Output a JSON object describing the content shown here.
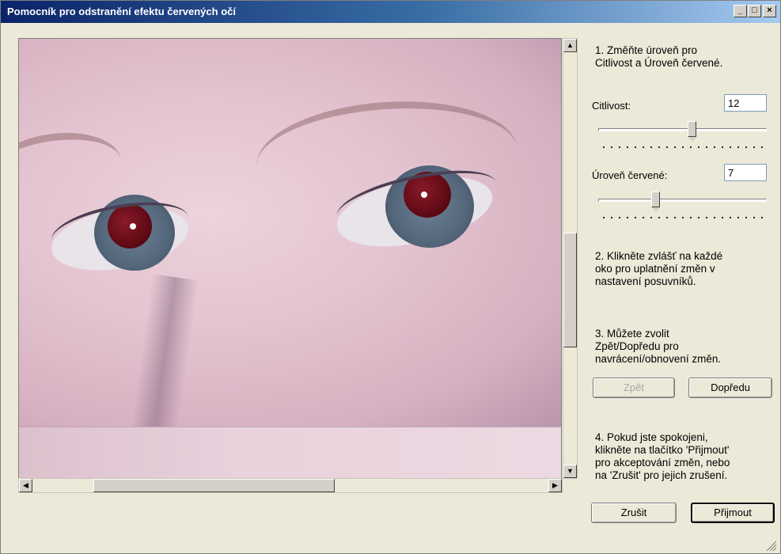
{
  "window": {
    "title": "Pomocník pro odstranění efektu červených očí",
    "minimize_glyph": "_",
    "maximize_glyph": "□",
    "close_glyph": "×"
  },
  "instructions": {
    "step1": "1. Změňte úroveň pro\nCitlivost a Úroveň červené.",
    "step2": "2. Klikněte zvlášť na každé\noko pro uplatnění změn v\nnastavení posuvníků.",
    "step3": "3. Můžete zvolit\nZpět/Dopředu pro\nnavrácení/obnovení změn.",
    "step4": "4. Pokud jste spokojeni,\nklikněte na tlačítko 'Přijmout'\npro akceptování změn, nebo\nna 'Zrušit' pro jejich zrušení."
  },
  "sensitivity": {
    "label": "Citlivost:",
    "value": "12",
    "slider_fraction": 0.56
  },
  "red_level": {
    "label": "Úroveň červené:",
    "value": "7",
    "slider_fraction": 0.33
  },
  "buttons": {
    "undo": "Zpět",
    "redo": "Dopředu",
    "cancel": "Zrušit",
    "accept": "Přijmout"
  },
  "scrollbar_icons": {
    "up": "▲",
    "down": "▼",
    "left": "◀",
    "right": "▶"
  },
  "icons": [
    "minimize-icon",
    "maximize-icon",
    "close-icon",
    "scroll-up-icon",
    "scroll-down-icon",
    "scroll-left-icon",
    "scroll-right-icon",
    "resize-grip-icon"
  ]
}
